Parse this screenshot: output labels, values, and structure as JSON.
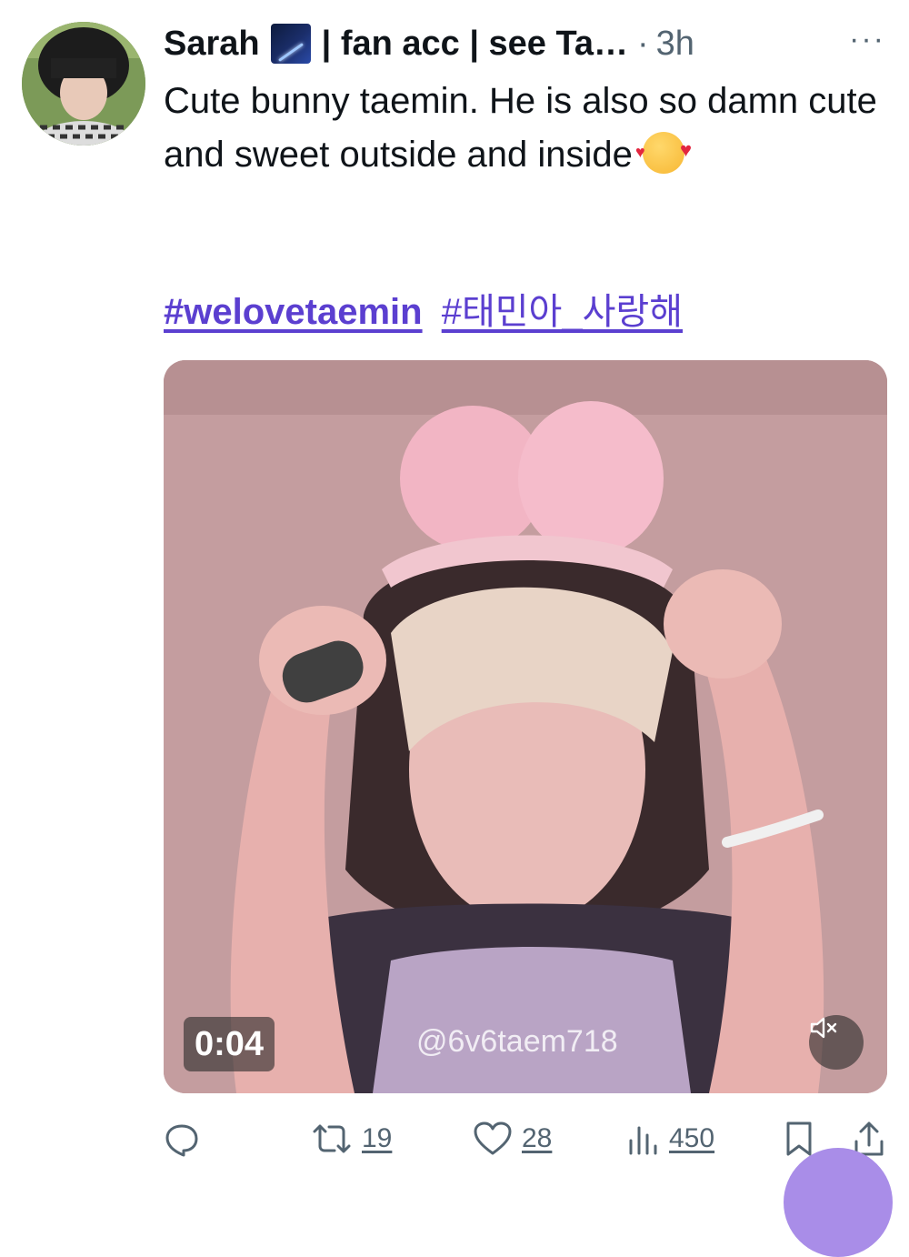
{
  "tweet": {
    "author_name": "Sarah",
    "author_suffix": "| fan acc | see Ta…",
    "dot": "·",
    "time": "3h",
    "more": "···",
    "text": "Cute bunny taemin. He is also so damn cute and sweet outside and inside",
    "hashtags": [
      "#welovetaemin",
      "#태민아_사랑해"
    ]
  },
  "media": {
    "duration": "0:04",
    "watermark": "@6v6taem718",
    "muted": true
  },
  "actions": {
    "reply": "",
    "retweets": "19",
    "likes": "28",
    "views": "450"
  },
  "colors": {
    "link": "#5b3fd0",
    "muted_text": "#536471",
    "fab": "#a98de8"
  }
}
